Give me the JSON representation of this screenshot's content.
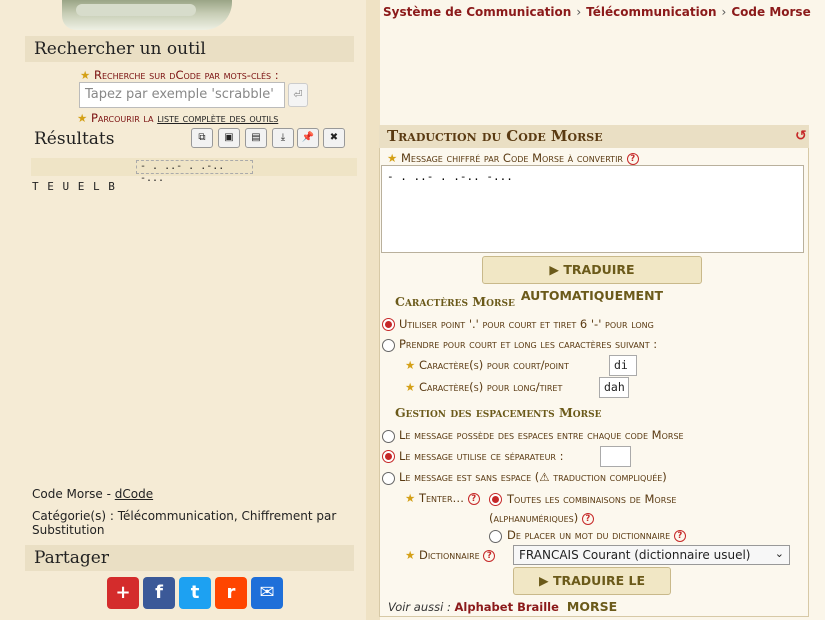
{
  "breadcrumb": [
    "Système de Communication",
    "Télécommunication",
    "Code Morse"
  ],
  "search": {
    "title": "Rechercher un outil",
    "keywords_label": "Recherche sur dCode par mots-clés :",
    "placeholder": "Tapez par exemple 'scrabble'",
    "browse_prefix": "Parcourir la ",
    "browse_link": "liste complète des outils"
  },
  "results": {
    "title": "Résultats",
    "morse_input_echo": "- . ..- . .-.. -...",
    "text": "T E U E L B",
    "tool_icons": [
      "copy-icon",
      "save-icon",
      "print-icon",
      "download-icon",
      "pin-icon",
      "close-icon"
    ],
    "tool_glyphs": [
      "⧉",
      "💾",
      "🖶",
      "⭳",
      "📌",
      "✖"
    ],
    "code_label": "Code Morse - ",
    "code_link": "dCode",
    "category": "Catégorie(s) : Télécommunication, Chiffrement par Substitution"
  },
  "share": {
    "title": "Partager",
    "buttons": [
      {
        "name": "share-addthis-icon",
        "glyph": "+",
        "color": "#d42c2c"
      },
      {
        "name": "share-facebook-icon",
        "glyph": "f",
        "color": "#3b5998"
      },
      {
        "name": "share-twitter-icon",
        "glyph": "t",
        "color": "#1da1f2"
      },
      {
        "name": "share-reddit-icon",
        "glyph": "r",
        "color": "#ff4500"
      },
      {
        "name": "share-email-icon",
        "glyph": "✉",
        "color": "#1e6fd9"
      }
    ]
  },
  "translator": {
    "title": "Traduction du Code Morse",
    "message_label": "Message chiffré par Code Morse à convertir",
    "message_value": "- . ..- . .-.. -...",
    "auto_button": "▶ TRADUIRE AUTOMATIQUEMENT",
    "chars_heading": "Caractères Morse",
    "opt_standard": "Utiliser point '.' pour court et tiret 6 '-' pour long",
    "opt_custom": "Prendre pour court et long les caractères suivant :",
    "short_label": "Caractère(s) pour court/point",
    "short_value": "di",
    "long_label": "Caractère(s) pour long/tiret",
    "long_value": "dah",
    "spacing_heading": "Gestion des espacements Morse",
    "space_opt1": "Le message possède des espaces entre chaque code Morse",
    "space_opt2": "Le message utilise ce séparateur :",
    "space_opt3": "Le message est sans espace (⚠ traduction compliquée)",
    "try_label": "Tenter…",
    "try_opt1a": "Toutes les combinaisons de Morse",
    "try_opt1b": "(alphanumériques)",
    "try_opt2": "De placer un mot du dictionnaire",
    "dict_label": "Dictionnaire",
    "dict_value": "FRANCAIS Courant (dictionnaire usuel)",
    "translate_button": "▶ TRADUIRE LE MORSE",
    "see_also": "Voir aussi : ",
    "see_also_link": "Alphabet Braille"
  }
}
